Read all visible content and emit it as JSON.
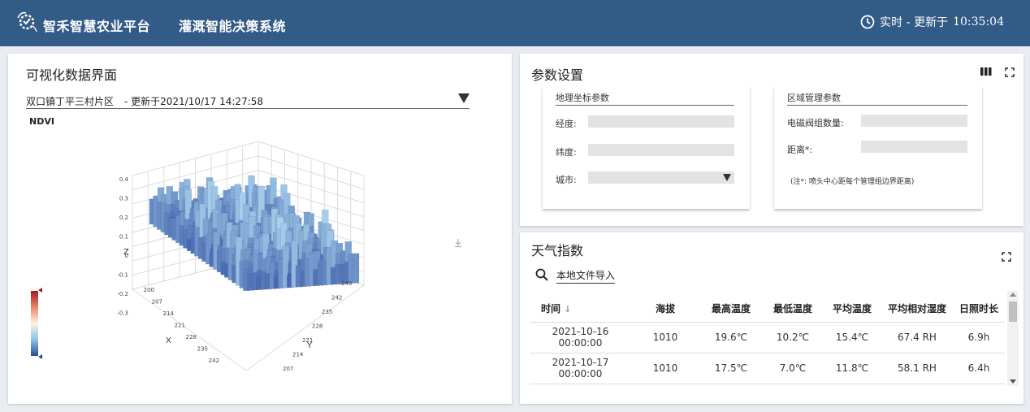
{
  "header": {
    "brand": "智禾智慧农业平台",
    "system": "灌溉智能决策系统",
    "status_prefix": "实时 - 更新于",
    "status_time": "10:35:04"
  },
  "viz": {
    "title": "可视化数据界面",
    "region": "双口镇丁平三村片区",
    "updated": "- 更新于2021/10/17 14:27:58",
    "plot_label": "NDVI",
    "z_label": "Z",
    "x_label": "X",
    "y_label": "Y",
    "z_ticks": [
      "0.4",
      "0.3",
      "0.2",
      "0.1",
      "0",
      "-0.1",
      "-0.2",
      "-0.3"
    ],
    "x_ticks": [
      "200",
      "207",
      "214",
      "221",
      "228",
      "235",
      "242"
    ],
    "y_ticks": [
      "207",
      "214",
      "221",
      "228",
      "235",
      "242",
      "249"
    ]
  },
  "params": {
    "title": "参数设置",
    "geo": {
      "title": "地理坐标参数",
      "longitude_label": "经度:",
      "latitude_label": "纬度:",
      "city_label": "城市:"
    },
    "zone": {
      "title": "区域管理参数",
      "valve_label": "电磁阀组数量:",
      "distance_label": "距离*:",
      "note": "(注*: 喷头中心距每个管理组边界距离)"
    }
  },
  "weather": {
    "title": "天气指数",
    "import_label": "本地文件导入",
    "columns": [
      "时间",
      "海拔",
      "最高温度",
      "最低温度",
      "平均温度",
      "平均相对湿度",
      "日照时长"
    ],
    "rows": [
      [
        "2021-10-16 00:00:00",
        "1010",
        "19.6℃",
        "10.2℃",
        "15.4℃",
        "67.4 RH",
        "6.9h"
      ],
      [
        "2021-10-17 00:00:00",
        "1010",
        "17.5℃",
        "7.0℃",
        "11.8℃",
        "58.1 RH",
        "6.4h"
      ]
    ]
  },
  "colors": {
    "header_bg": "#335b88",
    "surface_dark": "#2f4ea0",
    "surface_light": "#a9d3ee"
  }
}
